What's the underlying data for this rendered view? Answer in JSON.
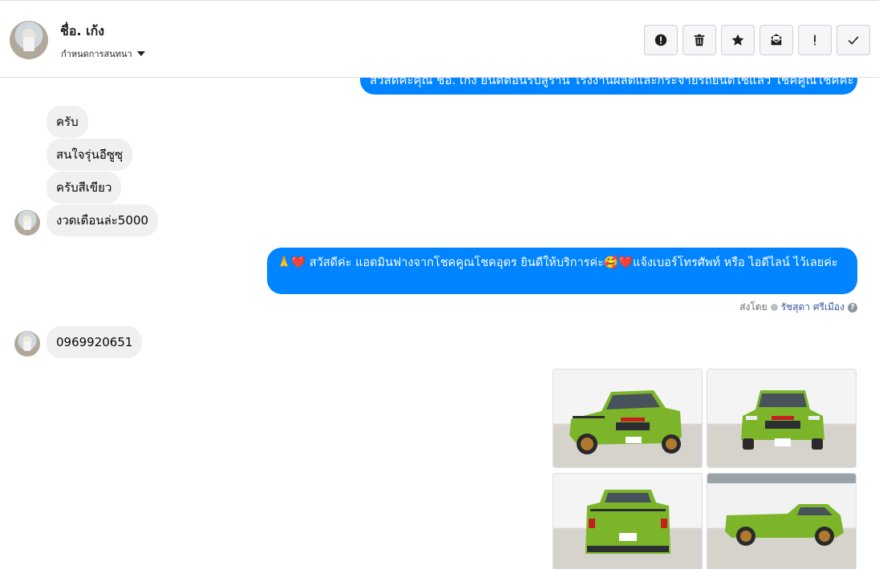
{
  "header": {
    "contact_name": "ชื่อ. เก้ง",
    "subtitle": "กำหนดการสนทนา"
  },
  "toolbar": [
    {
      "name": "mark-spam-button",
      "icon": "alert-circle-icon"
    },
    {
      "name": "delete-button",
      "icon": "trash-icon"
    },
    {
      "name": "star-button",
      "icon": "star-icon"
    },
    {
      "name": "mark-unread-button",
      "icon": "envelope-icon"
    },
    {
      "name": "follow-up-button",
      "icon": "exclamation-icon"
    },
    {
      "name": "mark-done-button",
      "icon": "check-icon"
    }
  ],
  "messages": {
    "top_outgoing": "สวัสดีค่ะคุณ ชื่อ. เก้ง ยินดีต้อนรับสู่ร้าน โรงงานผลิตและกระจายรถยนต์ใช้แล้ว โชคคูณโชคค่ะ",
    "in1": "ครับ",
    "in2": "สนใจรุ่นอีซูซุ",
    "in3": "ครับสีเขียว",
    "in4": "งวดเดือนล่ะ5000",
    "out_greeting": "🙏❤️ สวัสดีค่ะ แอดมินฟางจากโชคคูณโชคอุดร ยินดีให้บริการค่ะ🥰❤️แจ้งเบอร์โทรศัพท์ หรือ ไอดีไลน์  ไว้เลยค่ะ",
    "sent_by_prefix": "ส่งโดย",
    "sent_by_name": "รัชสุดา ศรีเมือง",
    "in_phone": "0969920651"
  },
  "colors": {
    "outgoing_bubble": "#0084ff",
    "incoming_bubble": "#f0f0f0",
    "truck_body": "#7db52a"
  }
}
